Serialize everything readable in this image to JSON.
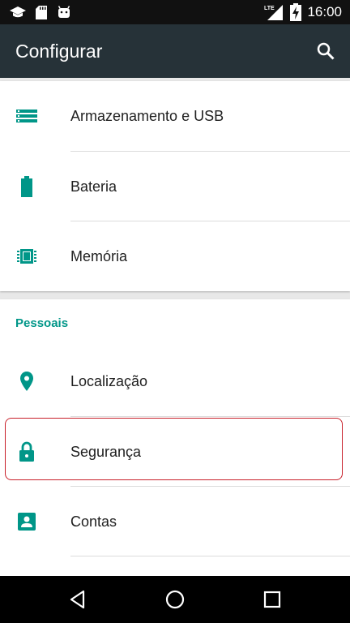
{
  "status_bar": {
    "time": "16:00",
    "network": "LTE",
    "icons": [
      "graduation-cap-icon",
      "sd-card-icon",
      "android-icon",
      "lte-signal-icon",
      "battery-charging-icon"
    ]
  },
  "app_bar": {
    "title": "Configurar",
    "search_icon": "search-icon"
  },
  "device_section": {
    "items": [
      {
        "label": "Armazenamento e USB",
        "icon": "storage-icon"
      },
      {
        "label": "Bateria",
        "icon": "battery-icon"
      },
      {
        "label": "Memória",
        "icon": "memory-icon"
      }
    ]
  },
  "personal_section": {
    "header": "Pessoais",
    "items": [
      {
        "label": "Localização",
        "icon": "location-pin-icon"
      },
      {
        "label": "Segurança",
        "icon": "lock-icon",
        "highlighted": true
      },
      {
        "label": "Contas",
        "icon": "account-box-icon"
      }
    ]
  },
  "nav_bar": {
    "buttons": [
      "back-icon",
      "home-icon",
      "recents-icon"
    ]
  },
  "colors": {
    "accent": "#009688",
    "app_bar": "#263238",
    "status_bar": "#111111",
    "highlight_border": "#c8202a"
  }
}
